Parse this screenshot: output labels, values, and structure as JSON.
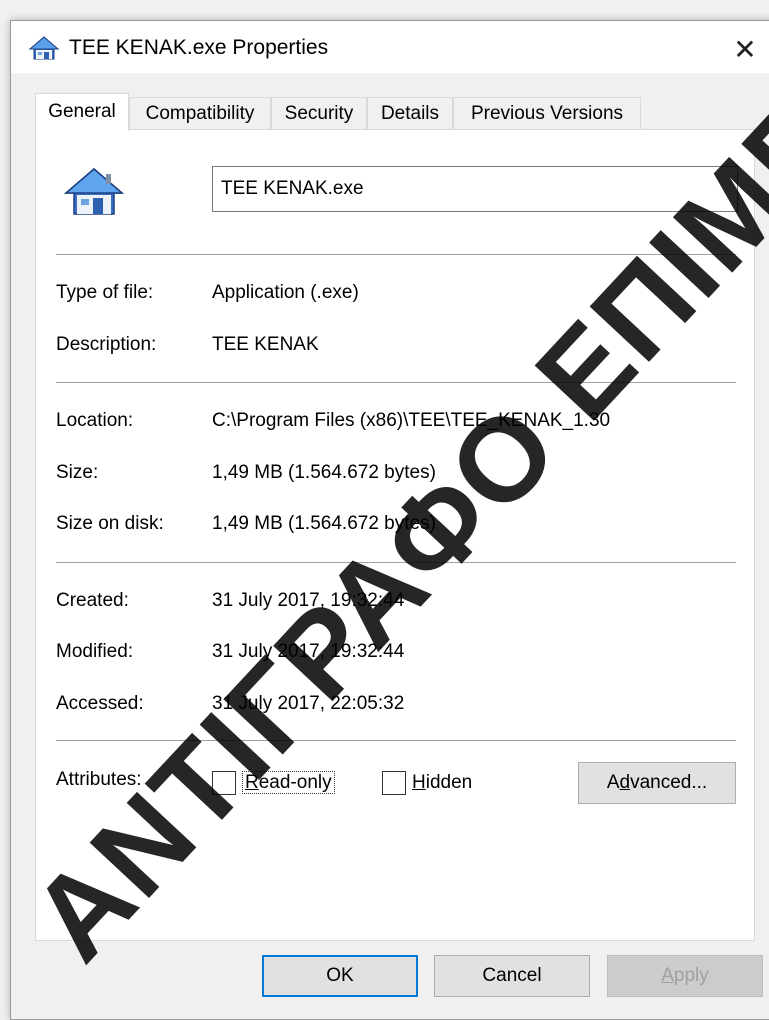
{
  "window": {
    "title": "TEE KENAK.exe Properties",
    "close_label": "✕"
  },
  "tabs": [
    {
      "label": "General",
      "active": true
    },
    {
      "label": "Compatibility",
      "active": false
    },
    {
      "label": "Security",
      "active": false
    },
    {
      "label": "Details",
      "active": false
    },
    {
      "label": "Previous Versions",
      "active": false
    }
  ],
  "general": {
    "file_name": "TEE KENAK.exe",
    "type_of_file_label": "Type of file:",
    "type_of_file_value": "Application (.exe)",
    "description_label": "Description:",
    "description_value": "TEE KENAK",
    "location_label": "Location:",
    "location_value": "C:\\Program Files (x86)\\TEE\\TEE_KENAK_1.30",
    "size_label": "Size:",
    "size_value": "1,49 MB (1.564.672 bytes)",
    "size_on_disk_label": "Size on disk:",
    "size_on_disk_value": "1,49 MB (1.564.672 bytes)",
    "created_label": "Created:",
    "created_value": "31 July 2017, 19:32:44",
    "modified_label": "Modified:",
    "modified_value": "31 July 2017, 19:32:44",
    "accessed_label": "Accessed:",
    "accessed_value": "31 July 2017, 22:05:32",
    "attributes_label": "Attributes:",
    "readonly_first": "R",
    "readonly_rest": "ead-only",
    "readonly_checked": false,
    "hidden_first": "H",
    "hidden_rest": "idden",
    "hidden_checked": false,
    "advanced_pre": "A",
    "advanced_mnemonic": "d",
    "advanced_post": "vanced..."
  },
  "footer": {
    "ok_label": "OK",
    "cancel_label": "Cancel",
    "apply_first": "A",
    "apply_rest": "pply"
  },
  "watermark": {
    "text": "ΑΝΤΙΓΡΑΦΟ ΕΠΙΜΕΛΗΤΗΡΙΟΥ"
  },
  "colors": {
    "accent": "#0078d7",
    "window_bg": "#f0f0f0",
    "panel_bg": "#ffffff",
    "separator": "#a0a0a0",
    "disabled_text": "#a0a0a0"
  },
  "icons": {
    "title": "house-icon",
    "file": "house-icon",
    "close": "close-icon"
  }
}
